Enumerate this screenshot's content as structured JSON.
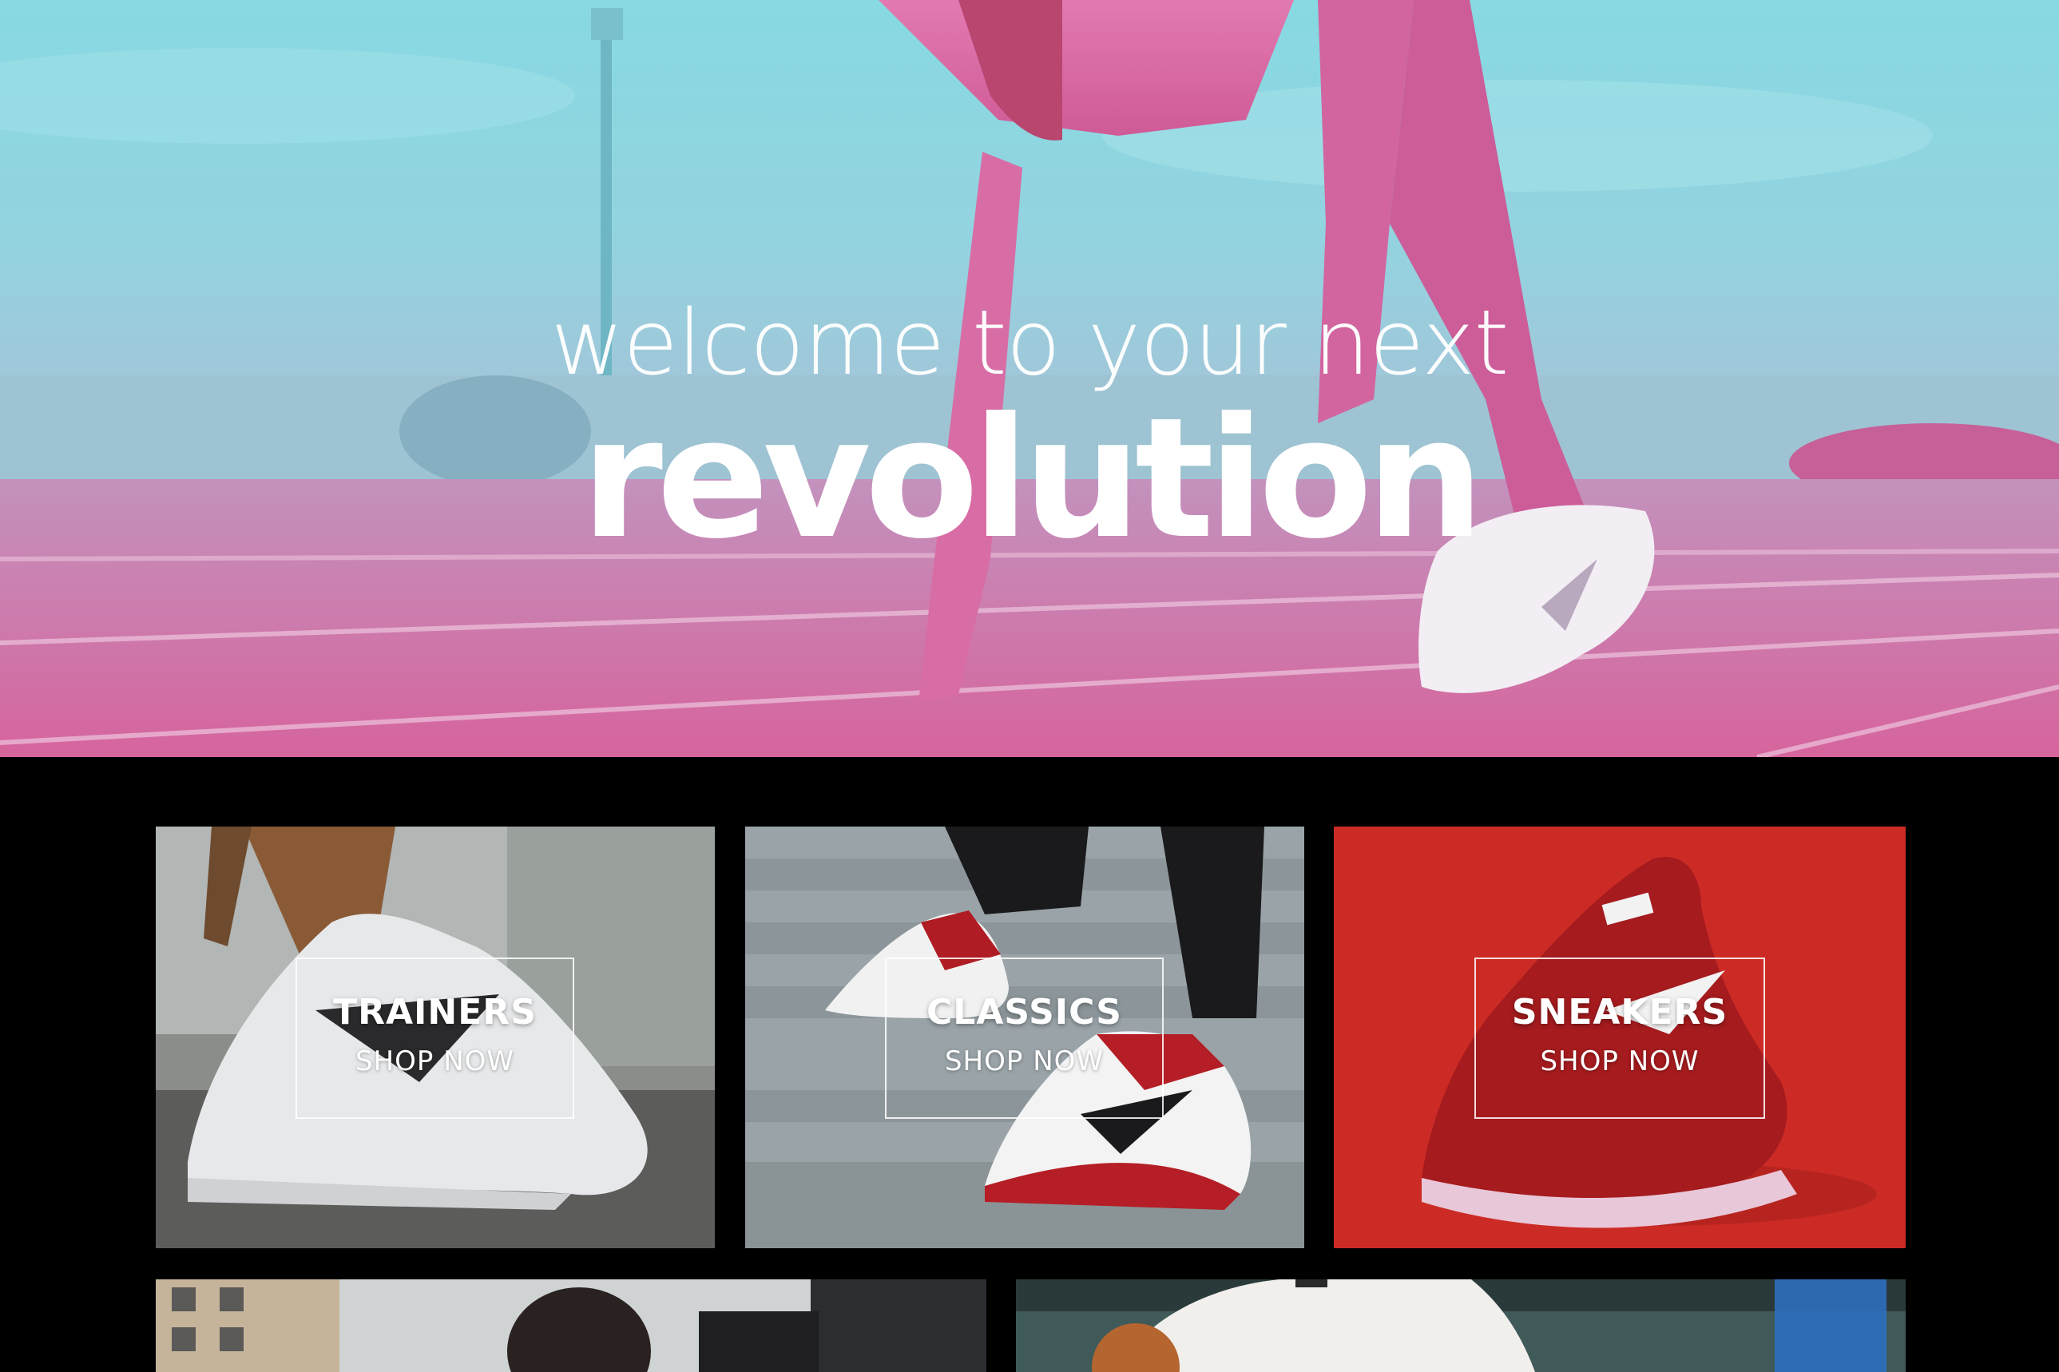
{
  "hero": {
    "line1": "welcome to your next",
    "line2": "revolution"
  },
  "categories": [
    {
      "title": "TRAINERS",
      "cta": "SHOP NOW",
      "image": "white-skate-shoe-photo"
    },
    {
      "title": "CLASSICS",
      "cta": "SHOP NOW",
      "image": "red-white-high-top-sneakers-photo"
    },
    {
      "title": "SNEAKERS",
      "cta": "SHOP NOW",
      "image": "red-knit-running-shoe-photo"
    }
  ],
  "bottom_images": [
    {
      "image": "athlete-stretching-photo"
    },
    {
      "image": "basketball-player-photo"
    }
  ],
  "colors": {
    "page_background": "#000000",
    "hero_cyan": "#7fd6e0",
    "hero_pink": "#e0609a",
    "sneakers_background": "#cc2b25"
  }
}
